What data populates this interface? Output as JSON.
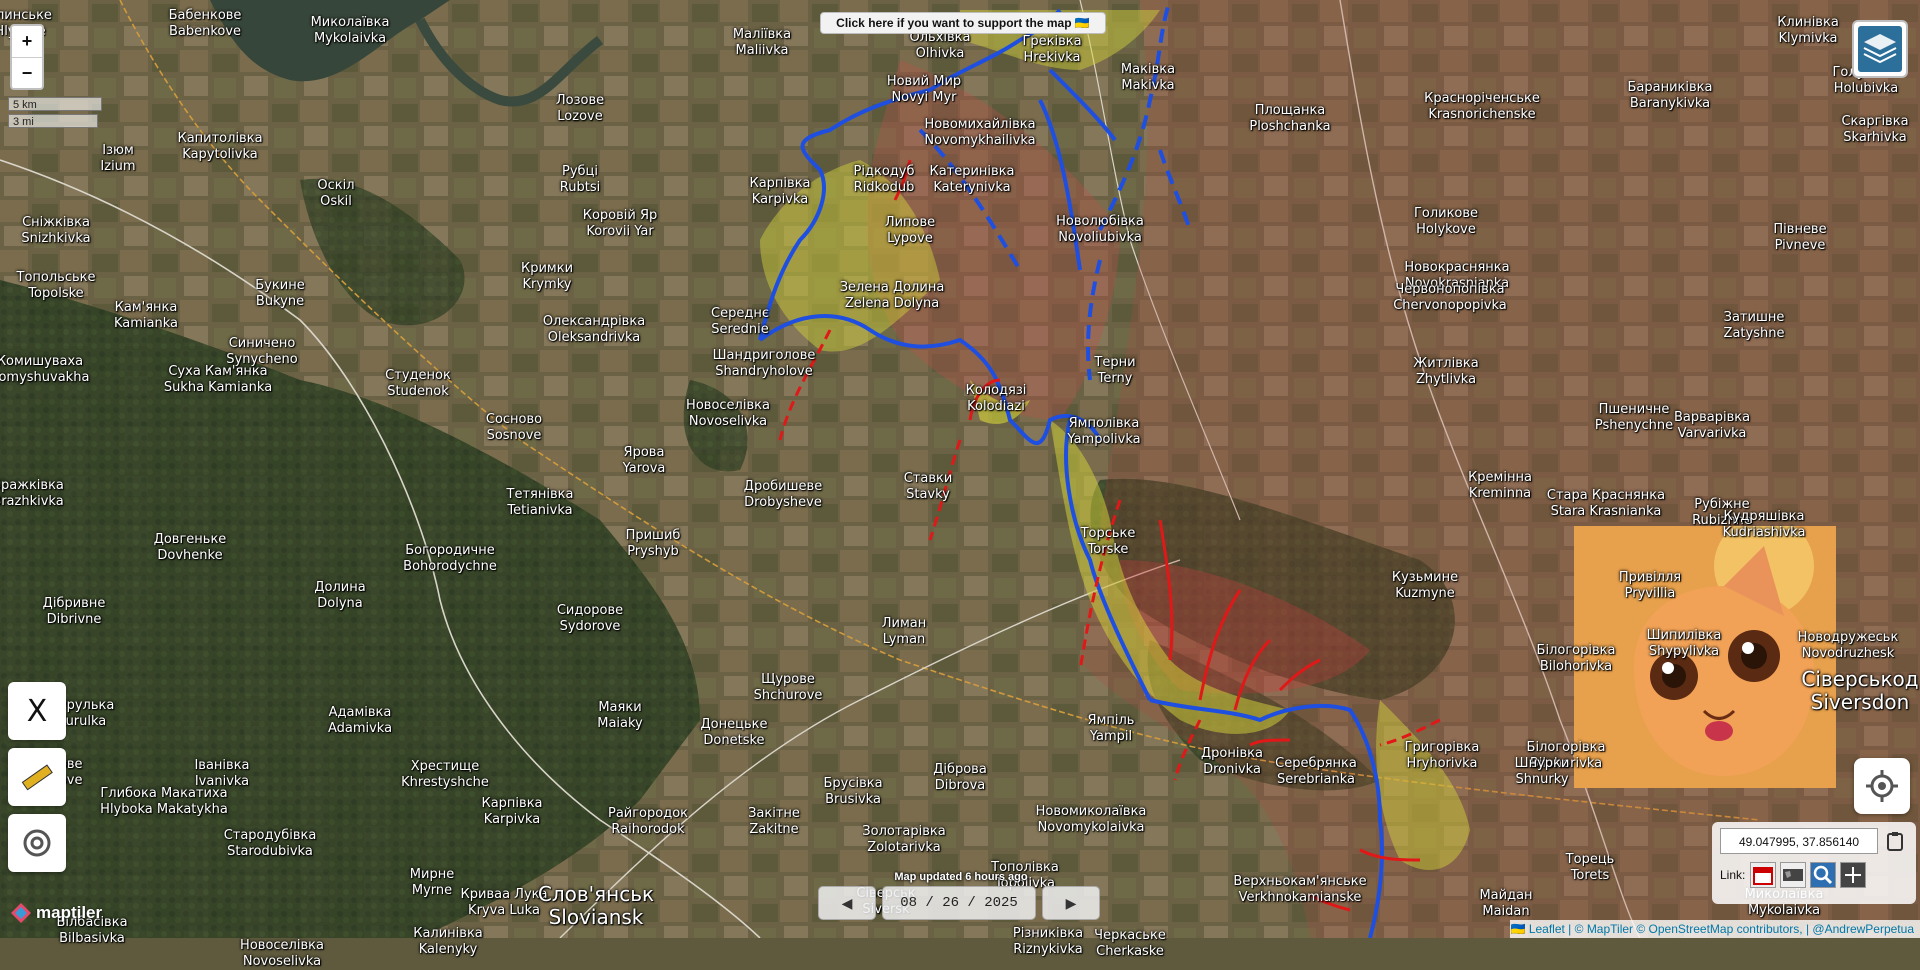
{
  "banner": {
    "text": "Click here if you want to support the map 🇺🇦"
  },
  "zoom": {
    "in": "+",
    "out": "−"
  },
  "scale": {
    "km": "5 km",
    "mi": "3 mi"
  },
  "status": {
    "updated": "Map updated 6 hours ago"
  },
  "date": {
    "value": "08 / 26 / 2025",
    "prev": "◀",
    "next": "▶"
  },
  "coords": {
    "value": "49.047995, 37.856140",
    "link_label": "Link:"
  },
  "attribution": {
    "text": "🇺🇦 Leaflet | © MapTiler © OpenStreetMap contributors, | @AndrewPerpetua"
  },
  "logo": {
    "text": "maptiler"
  },
  "controls": {
    "x_label": "X"
  },
  "colors": {
    "friendly_front": "#1f4fe0",
    "enemy_advance": "#e01818",
    "contested_zone": "#d8d83a",
    "occupied_zone": "#c84a4a"
  },
  "places": [
    {
      "t": "Глинське",
      "l": "Hlynske"
    },
    {
      "t": "Бабенкове",
      "l": "Babenkove"
    },
    {
      "t": "Миколаївка",
      "l": "Mykolaivka"
    },
    {
      "t": "Маліївка",
      "l": "Maliivka"
    },
    {
      "t": "Ольхівка",
      "l": "Olhivka"
    },
    {
      "t": "Грекiвка",
      "l": "Hrekivka"
    },
    {
      "t": "Маківка",
      "l": "Makivka"
    },
    {
      "t": "Клинівка",
      "l": "Klymivka"
    },
    {
      "t": "Голубівка",
      "l": "Holubivka"
    },
    {
      "t": "Новий Мир",
      "l": "Novyi Myr"
    },
    {
      "t": "Лозове",
      "l": "Lozove"
    },
    {
      "t": "Новомихайлівка",
      "l": "Novomykhailivka"
    },
    {
      "t": "Площанка",
      "l": "Ploshchanka"
    },
    {
      "t": "Красноріченське",
      "l": "Krasnorichenske"
    },
    {
      "t": "Бараникiвка",
      "l": "Baranykivka"
    },
    {
      "t": "Скаргівка",
      "l": "Skarhivka"
    },
    {
      "t": "Капитолівка",
      "l": "Kapytolivka"
    },
    {
      "t": "Ізюм",
      "l": "Izium"
    },
    {
      "t": "Рубці",
      "l": "Rubtsi"
    },
    {
      "t": "Оскіл",
      "l": "Oskil"
    },
    {
      "t": "Карпівка",
      "l": "Karpivka"
    },
    {
      "t": "Рідкодуб",
      "l": "Ridkodub"
    },
    {
      "t": "Катеринівка",
      "l": "Katerynivka"
    },
    {
      "t": "Липове",
      "l": "Lypove"
    },
    {
      "t": "Новолюбівка",
      "l": "Novoliubivka"
    },
    {
      "t": "Голикове",
      "l": "Holykove"
    },
    {
      "t": "Пiвневе",
      "l": "Pivneve"
    },
    {
      "t": "Сніжківка",
      "l": "Snizhkivka"
    },
    {
      "t": "Коровій Яр",
      "l": "Korovii Yar"
    },
    {
      "t": "Кримки",
      "l": "Krymky"
    },
    {
      "t": "Новокраснянка",
      "l": "Novokrasnianka"
    },
    {
      "t": "Зелена Долина",
      "l": "Zelena Dolyna"
    },
    {
      "t": "Червонопопівка",
      "l": "Chervonopopivka"
    },
    {
      "t": "Затишне",
      "l": "Zatyshne"
    },
    {
      "t": "Топольське",
      "l": "Topolske"
    },
    {
      "t": "Букине",
      "l": "Bukyne"
    },
    {
      "t": "Кам'янка",
      "l": "Kamianka"
    },
    {
      "t": "Середнє",
      "l": "Serednie"
    },
    {
      "t": "Олександрівка",
      "l": "Oleksandrivka"
    },
    {
      "t": "Синичено",
      "l": "Synycheno"
    },
    {
      "t": "Шандриголове",
      "l": "Shandryholove"
    },
    {
      "t": "Житлівка",
      "l": "Zhytlivka"
    },
    {
      "t": "Терни",
      "l": "Terny"
    },
    {
      "t": "Комишуваха",
      "l": "Komyshuvakha"
    },
    {
      "t": "Суха Кам'янка",
      "l": "Sukha Kamianka"
    },
    {
      "t": "Студенок",
      "l": "Studenok"
    },
    {
      "t": "Колодязі",
      "l": "Kolodiazi"
    },
    {
      "t": "Пшеничне",
      "l": "Pshenychne"
    },
    {
      "t": "Варварівка",
      "l": "Varvarivka"
    },
    {
      "t": "Сосново",
      "l": "Sosnove"
    },
    {
      "t": "Новоселівка",
      "l": "Novoselivka"
    },
    {
      "t": "Ямполівка",
      "l": "Yampolivka"
    },
    {
      "t": "Ярова",
      "l": "Yarova"
    },
    {
      "t": "Кремінна",
      "l": "Kreminna"
    },
    {
      "t": "Стара Краснянка",
      "l": "Stara Krasnianka"
    },
    {
      "t": "Рубіжне",
      "l": "Rubizhne"
    },
    {
      "t": "Бражківка",
      "l": "Brazhkivka"
    },
    {
      "t": "Ставки",
      "l": "Stavky"
    },
    {
      "t": "Дробишеве",
      "l": "Drobysheve"
    },
    {
      "t": "Тетянівка",
      "l": "Tetianivka"
    },
    {
      "t": "Кудряшівка",
      "l": "Kudriashivka"
    },
    {
      "t": "Торське",
      "l": "Torske"
    },
    {
      "t": "Пришиб",
      "l": "Pryshyb"
    },
    {
      "t": "Довгеньке",
      "l": "Dovhenke"
    },
    {
      "t": "Богородичне",
      "l": "Bohorodychne"
    },
    {
      "t": "Кузьмине",
      "l": "Kuzmyne"
    },
    {
      "t": "Долина",
      "l": "Dolyna"
    },
    {
      "t": "Привілля",
      "l": "Pryvillia"
    },
    {
      "t": "Дібривне",
      "l": "Dibrivne"
    },
    {
      "t": "Сидорове",
      "l": "Sydorove"
    },
    {
      "t": "Лиман",
      "l": "Lyman"
    },
    {
      "t": "Білогорівка",
      "l": "Bilohorivka"
    },
    {
      "t": "Шипилівка",
      "l": "Shypylivka"
    },
    {
      "t": "Новодружеськ",
      "l": "Novodruzhesk"
    },
    {
      "t": "Щурове",
      "l": "Shchurove"
    },
    {
      "t": "Курулька",
      "l": "Kurulka"
    },
    {
      "t": "Адамівка",
      "l": "Adamivka"
    },
    {
      "t": "Маяки",
      "l": "Maiaky"
    },
    {
      "t": "Донецьке",
      "l": "Donetske"
    },
    {
      "t": "Ямпіль",
      "l": "Yampil"
    },
    {
      "t": "Пашкове",
      "l": "Pashkove"
    },
    {
      "t": "Іванівка",
      "l": "Ivanivka"
    },
    {
      "t": "Хрестище",
      "l": "Khrestyshche"
    },
    {
      "t": "Брусівка",
      "l": "Brusivka"
    },
    {
      "t": "Діброва",
      "l": "Dibrova"
    },
    {
      "t": "Дронівка",
      "l": "Dronivka"
    },
    {
      "t": "Серебрянка",
      "l": "Serebrianka"
    },
    {
      "t": "Григорівка",
      "l": "Hryhorivka"
    },
    {
      "t": "Білогорівка",
      "l": "Bilohorivka"
    },
    {
      "t": "Шнурки",
      "l": "Shnurky"
    },
    {
      "t": "Глибока Макатиха",
      "l": "Hlyboka Makatykha"
    },
    {
      "t": "Карпівка",
      "l": "Karpivka"
    },
    {
      "t": "Райгородок",
      "l": "Raihorodok"
    },
    {
      "t": "Закітне",
      "l": "Zakitne"
    },
    {
      "t": "Новомиколаївка",
      "l": "Novomykolaivka"
    },
    {
      "t": "Стародубівка",
      "l": "Starodubivka"
    },
    {
      "t": "Золотарівка",
      "l": "Zolotarivka"
    },
    {
      "t": "Торець",
      "l": "Torets"
    },
    {
      "t": "Мирне",
      "l": "Myrne"
    },
    {
      "t": "Криваа Лука",
      "l": "Kryva Luka"
    },
    {
      "t": "Тополівка",
      "l": "Topolivka"
    },
    {
      "t": "Миколаївка",
      "l": "Mykolaivka"
    },
    {
      "t": "Сіверськ",
      "l": "Siversk"
    },
    {
      "t": "Верхньокам'янське",
      "l": "Verkhnokamianske"
    },
    {
      "t": "Майдан",
      "l": "Maidan"
    },
    {
      "t": "Білбасівка",
      "l": "Bilbasivka"
    },
    {
      "t": "Калинівка",
      "l": "Kalenyky"
    },
    {
      "t": "Різниківка",
      "l": "Riznykivka"
    },
    {
      "t": "Черкаське",
      "l": "Cherkaske"
    },
    {
      "t": "Новоселівка",
      "l": "Novoselivka"
    }
  ],
  "big_places": [
    {
      "t": "Слов'янськ",
      "l": "Sloviansk"
    },
    {
      "t": "Сіверськод",
      "l": "Siversdon"
    }
  ]
}
